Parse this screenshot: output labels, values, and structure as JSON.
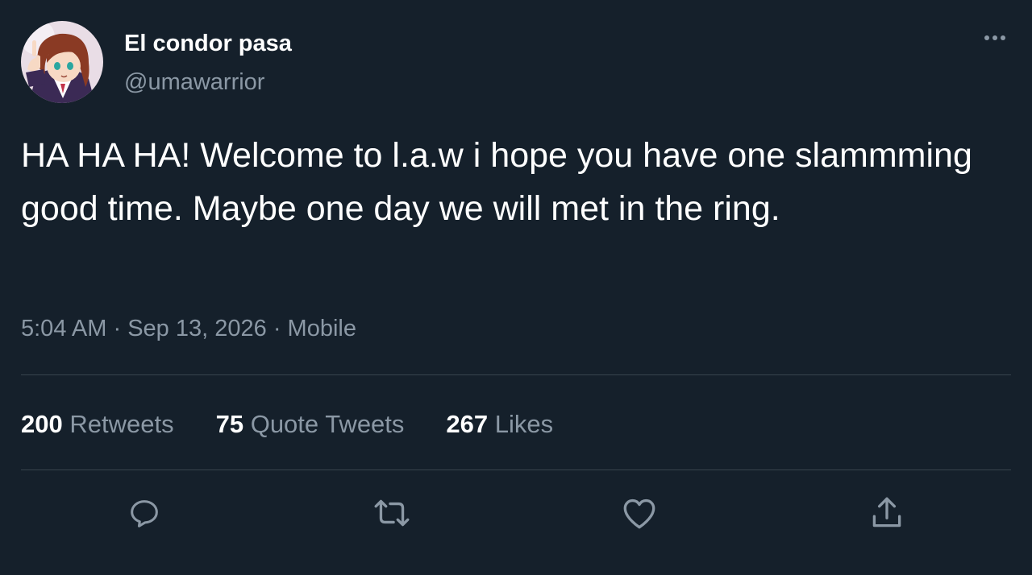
{
  "user": {
    "display_name": "El condor pasa",
    "handle": "@umawarrior"
  },
  "tweet": {
    "text": "HA HA HA! Welcome to l.a.w i hope you have one slammming good time. Maybe one day we will met in the ring.",
    "time": "5:04 AM",
    "separator": "·",
    "date": "Sep 13, 2026",
    "source": "Mobile"
  },
  "stats": {
    "retweets_count": "200",
    "retweets_label": "Retweets",
    "quotes_count": "75",
    "quotes_label": "Quote Tweets",
    "likes_count": "267",
    "likes_label": "Likes"
  },
  "icons": {
    "more": "more-icon",
    "reply": "reply-icon",
    "retweet": "retweet-icon",
    "like": "heart-icon",
    "share": "share-icon"
  },
  "colors": {
    "background": "#15202b",
    "text": "#ffffff",
    "secondary": "#8b98a5",
    "divider": "#38444d"
  }
}
